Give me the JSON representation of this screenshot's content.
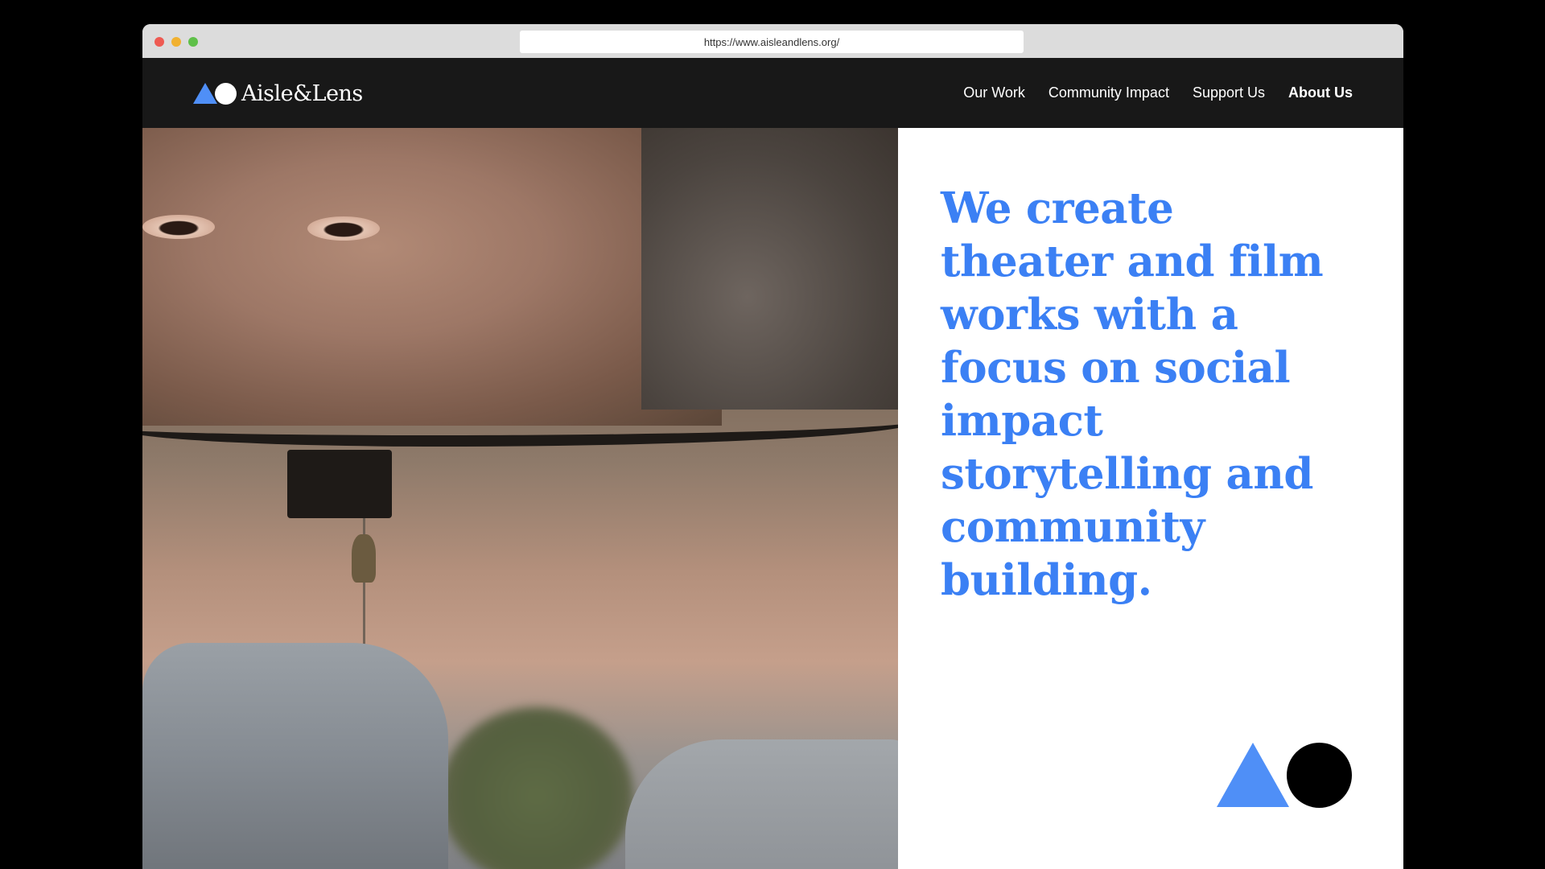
{
  "browser": {
    "url": "https://www.aisleandlens.org/"
  },
  "brand": {
    "name": "Aisle&Lens",
    "accent_color": "#4f8ff7"
  },
  "nav": {
    "items": [
      {
        "label": "Our Work",
        "active": false
      },
      {
        "label": "Community Impact",
        "active": false
      },
      {
        "label": "Support Us",
        "active": false
      },
      {
        "label": "About Us",
        "active": true
      }
    ]
  },
  "hero": {
    "headline": "We create theater and film works with a focus on social impact storytelling and community building.",
    "headline_color": "#3b80f4",
    "image_subject": "woman reflected in car rearview mirror"
  },
  "decor": {
    "icons": [
      "triangle-icon",
      "circle-icon"
    ]
  }
}
